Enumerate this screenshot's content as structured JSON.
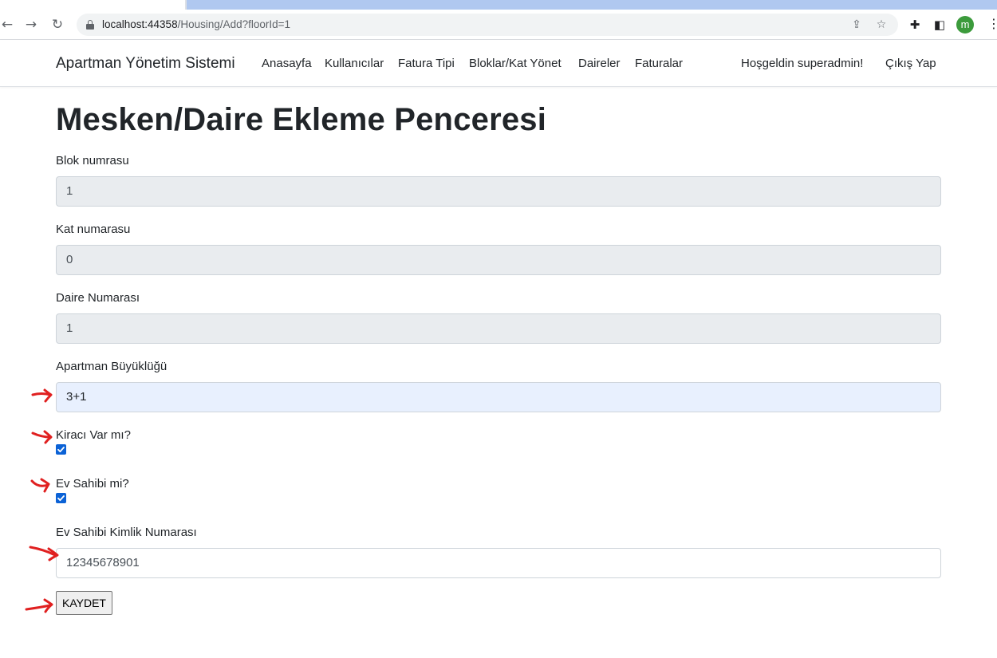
{
  "browser": {
    "url_host": "localhost:44358",
    "url_path": "/Housing/Add?floorId=1",
    "avatar_letter": "m",
    "icons": [
      "back-arrow-icon",
      "forward-arrow-icon",
      "reload-icon",
      "lock-icon",
      "share-icon",
      "star-icon",
      "extensions-icon",
      "sidebar-icon",
      "menu-icon"
    ]
  },
  "navbar": {
    "brand": "Apartman Yönetim Sistemi",
    "links": [
      "Anasayfa",
      "Kullanıcılar",
      "Fatura Tipi",
      "Bloklar/Kat Yönet",
      "Daireler",
      "Faturalar"
    ],
    "greeting": "Hoşgeldin superadmin!",
    "logout": "Çıkış Yap"
  },
  "form": {
    "title": "Mesken/Daire Ekleme Penceresi",
    "block_label": "Blok numrasu",
    "block_value": "1",
    "floor_label": "Kat numarasu",
    "floor_value": "0",
    "door_label": "Daire Numarası",
    "door_value": "1",
    "size_label": "Apartman Büyüklüğü",
    "size_value": "3+1",
    "tenant_label": "Kiracı Var mı?",
    "tenant_checked": true,
    "owner_label": "Ev Sahibi mi?",
    "owner_checked": true,
    "owner_id_label": "Ev Sahibi Kimlik Numarası",
    "owner_id_value": "12345678901",
    "submit_label": "KAYDET"
  },
  "colors": {
    "annotation": "#e02020",
    "checkbox": "#0b62d6",
    "readonly_bg": "#e9ecef",
    "autofill_bg": "#e8f0fe"
  }
}
